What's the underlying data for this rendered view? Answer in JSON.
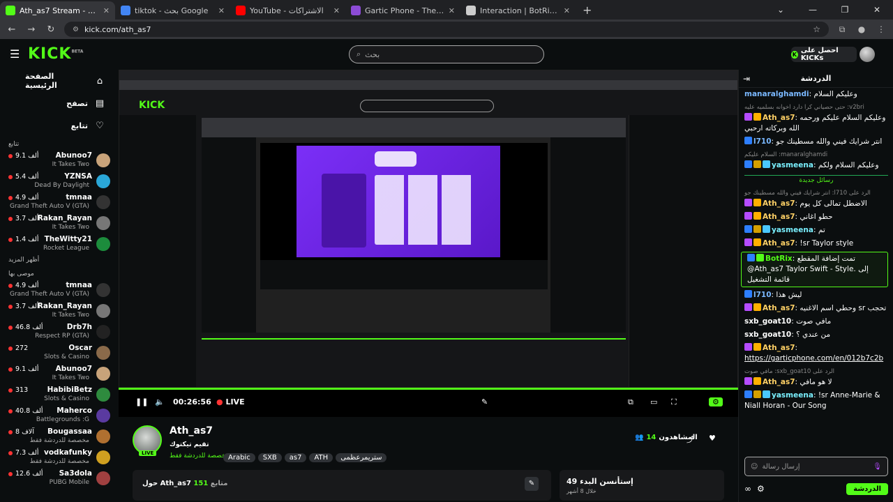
{
  "browser": {
    "tabs": [
      {
        "title": "Ath_as7 Stream - Watch Live",
        "color": "#53fc18",
        "active": true
      },
      {
        "title": "tiktok - بحث Google",
        "color": "#4285f4"
      },
      {
        "title": "YouTube - الاشتراكات",
        "color": "#ff0000"
      },
      {
        "title": "Gartic Phone - The Telephone",
        "color": "#8c4bd6"
      },
      {
        "title": "Interaction | BotRix — Cloud",
        "color": "#cccccc"
      }
    ],
    "new_tab": "+",
    "url": "kick.com/ath_as7"
  },
  "header": {
    "logo": "KICK",
    "logo_sup": "BETA",
    "search_placeholder": "بحث",
    "kicks_label": "احصل على KICKs"
  },
  "sidebar": {
    "nav": [
      {
        "label": "الصفحة الرئيسية",
        "icon": "home-icon",
        "glyph": "⌂"
      },
      {
        "label": "تصفح",
        "icon": "browse-icon",
        "glyph": "▤"
      },
      {
        "label": "تتابع",
        "icon": "heart-icon",
        "glyph": "♡"
      }
    ],
    "following_title": "تتابع",
    "show_more": "أظهر المزيد",
    "recommended_title": "موصى بها",
    "following": [
      {
        "name": "Abunoo7",
        "game": "It Takes Two",
        "viewers": "9.1 ألف",
        "color": "#c8a37a"
      },
      {
        "name": "YZNSA",
        "game": "Dead By Daylight",
        "viewers": "5.4 ألف",
        "color": "#2aa7d8"
      },
      {
        "name": "tmnaa",
        "game": "Grand Theft Auto V (GTA)",
        "viewers": "4.9 ألف",
        "color": "#333333"
      },
      {
        "name": "Rakan_Rayan",
        "game": "It Takes Two",
        "viewers": "3.7 ألف",
        "color": "#777777"
      },
      {
        "name": "TheWitty21",
        "game": "Rocket League",
        "viewers": "1.4 ألف",
        "color": "#1c8c3c"
      }
    ],
    "recommended": [
      {
        "name": "tmnaa",
        "game": "Grand Theft Auto V (GTA)",
        "viewers": "4.9 ألف",
        "color": "#333333"
      },
      {
        "name": "Rakan_Rayan",
        "game": "It Takes Two",
        "viewers": "3.7 ألف",
        "color": "#777777"
      },
      {
        "name": "Drb7h",
        "game": "Respect RP (GTA)",
        "viewers": "46.8 ألف",
        "color": "#222222"
      },
      {
        "name": "Oscar",
        "game": "Slots & Casino",
        "viewers": "272",
        "color": "#8a6a4a"
      },
      {
        "name": "Abunoo7",
        "game": "It Takes Two",
        "viewers": "9.1 ألف",
        "color": "#c8a37a"
      },
      {
        "name": "HabibiBetz",
        "game": "Slots & Casino",
        "viewers": "313",
        "color": "#2e8b3e"
      },
      {
        "name": "Maherco",
        "game": "Battlegrounds :G",
        "viewers": "40.8 ألف",
        "color": "#5a3aa0"
      },
      {
        "name": "Bougassaa",
        "game": "مخصصة للدردشة فقط",
        "viewers": "8 آلاف",
        "color": "#b07030"
      },
      {
        "name": "vodkafunky",
        "game": "مخصصة للدردشة فقط",
        "viewers": "7.3 ألف",
        "color": "#d0a020"
      },
      {
        "name": "Sa3dola",
        "game": "PUBG Mobile",
        "viewers": "12.6 ألف",
        "color": "#a04040"
      }
    ]
  },
  "player": {
    "time": "00:26:56",
    "live_label": "LIVE",
    "progress": 1.0,
    "viewer_label": "ath_as7",
    "viewer_count": "151",
    "viewers_since": "49",
    "since_label": "إستأنسن البدء"
  },
  "streamer": {
    "name": "Ath_as7",
    "subtitle": "تقيم تيكتوك",
    "category": "مخصصة للدردشة فقط",
    "tags": [
      "Arabic",
      "SXB",
      "as7",
      "ATH",
      "ستريمرعظمى"
    ],
    "viewers_label": "المشاهدون",
    "viewers": "14",
    "about_label": "حول Ath_as7",
    "followers_label": "متابع",
    "followers": "151",
    "since_count": "49",
    "since_label": "إستأنسن البدء",
    "since_sub": "خلال 8 أشهر"
  },
  "chat": {
    "title": "الدردشة",
    "messages": [
      {
        "user": "manaralghamdi",
        "text": "وعليكم السلام",
        "color": "#7ab8ff"
      },
      {
        "reply": "حتى حصياني كرا دارد اخوانه بسلميه عليه :v2bri",
        "user": "Ath_as7",
        "text": "وعليكم السلام عليكم ورحمه الله وبركاته ارحبي",
        "color": "#ffd166",
        "badges": [
          "#b54cff",
          "#ffb000"
        ]
      },
      {
        "user": "l710",
        "text": "انتر شرايك فيني والله مسطينك جو",
        "color": "#7ab8ff",
        "badges": [
          "#2d7fff"
        ]
      },
      {
        "reply": "السلام عليكم :manaralghamdi",
        "user": "yasmeena",
        "text": "وعليكم السلام ولكم",
        "color": "#7af0ff",
        "badges": [
          "#2d7fff",
          "#d4a000",
          "#4ac8ff"
        ]
      },
      {
        "separator": "رسائل جديدة"
      },
      {
        "reply": "انتر شرايك فيني والله مسطينك جو :l710 الرد على",
        "user": "Ath_as7",
        "text": "الاضطل تمالى كل يوم",
        "color": "#ffd166",
        "badges": [
          "#b54cff",
          "#ffb000"
        ]
      },
      {
        "user": "Ath_as7",
        "text": "حطو اغاني",
        "color": "#ffd166",
        "badges": [
          "#b54cff",
          "#ffb000"
        ]
      },
      {
        "user": "yasmeena",
        "text": "تم",
        "color": "#7af0ff",
        "badges": [
          "#2d7fff",
          "#d4a000",
          "#4ac8ff"
        ]
      },
      {
        "user": "Ath_as7",
        "text": "!sr Taylor style",
        "color": "#ffd166",
        "badges": [
          "#b54cff",
          "#ffb000"
        ]
      },
      {
        "user": "BotRix",
        "text": "تمت إضافة المقطع @Ath_as7 Taylor Swift - Style. إلى قائمة التشغيل",
        "color": "#53fc18",
        "badges": [
          "#2d7fff",
          "#53fc18"
        ],
        "highlight": true
      },
      {
        "user": "l710",
        "text": "ليش هذا",
        "color": "#7ab8ff",
        "badges": [
          "#2d7fff"
        ]
      },
      {
        "user": "Ath_as7",
        "text": "وحطي اسم الاغنيه sr تحجب",
        "color": "#ffd166",
        "badges": [
          "#b54cff",
          "#ffb000"
        ]
      },
      {
        "user": "sxb_goat10",
        "text": "مافي صوت",
        "color": "#ffffff"
      },
      {
        "user": "sxb_goat10",
        "text": "من عندي ؟",
        "color": "#ffffff"
      },
      {
        "user": "Ath_as7",
        "text": "https://garticphone.com/en/012b7c2b",
        "color": "#ffd166",
        "badges": [
          "#b54cff",
          "#ffb000"
        ]
      },
      {
        "reply": "مافي صوت :sxb_goat10 الرد على",
        "user": "Ath_as7",
        "text": "لا هو مافي",
        "color": "#ffd166",
        "badges": [
          "#b54cff",
          "#ffb000"
        ]
      },
      {
        "user": "yasmeena",
        "text": "!sr Anne-Marie & Niall Horan - Our Song",
        "color": "#7af0ff",
        "badges": [
          "#2d7fff",
          "#d4a000",
          "#4ac8ff"
        ]
      }
    ],
    "input_placeholder": "إرسال رسالة",
    "send_label": "الدردشة"
  }
}
